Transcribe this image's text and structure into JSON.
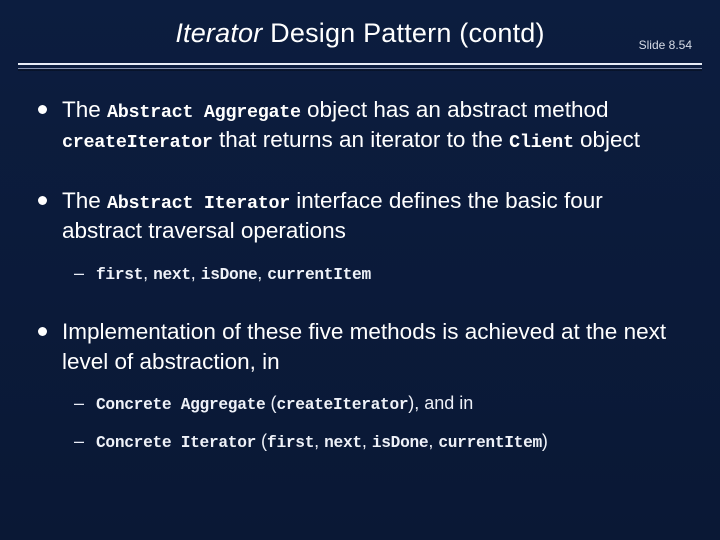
{
  "title_italic": "Iterator",
  "title_rest": " Design Pattern (contd)",
  "slide_number": "Slide 8.54",
  "bullets": [
    {
      "seg": [
        {
          "t": "The "
        },
        {
          "t": "Abstract Aggregate",
          "m": true
        },
        {
          "t": " object has an abstract method "
        },
        {
          "t": "createIterator",
          "m": true
        },
        {
          "t": " that returns an iterator to the "
        },
        {
          "t": "Client",
          "m": true
        },
        {
          "t": " object"
        }
      ]
    },
    {
      "seg": [
        {
          "t": "The "
        },
        {
          "t": "Abstract Iterator",
          "m": true
        },
        {
          "t": " interface defines the basic four abstract traversal operations"
        }
      ],
      "sub": [
        {
          "seg": [
            {
              "t": "first",
              "m": true
            },
            {
              "t": ", "
            },
            {
              "t": "next",
              "m": true
            },
            {
              "t": ", "
            },
            {
              "t": "isDone",
              "m": true
            },
            {
              "t": ", "
            },
            {
              "t": "currentItem",
              "m": true
            }
          ]
        }
      ]
    },
    {
      "seg": [
        {
          "t": "Implementation of these five methods is achieved at the next level of abstraction, in"
        }
      ],
      "sub": [
        {
          "seg": [
            {
              "t": "Concrete Aggregate",
              "m": true
            },
            {
              "t": " ("
            },
            {
              "t": "createIterator",
              "m": true
            },
            {
              "t": "), and in"
            }
          ]
        },
        {
          "seg": [
            {
              "t": "Concrete Iterator",
              "m": true
            },
            {
              "t": " ("
            },
            {
              "t": "first",
              "m": true
            },
            {
              "t": ", "
            },
            {
              "t": "next",
              "m": true
            },
            {
              "t": ", "
            },
            {
              "t": "isDone",
              "m": true
            },
            {
              "t": ", "
            },
            {
              "t": "currentItem",
              "m": true
            },
            {
              "t": ")"
            }
          ]
        }
      ]
    }
  ]
}
